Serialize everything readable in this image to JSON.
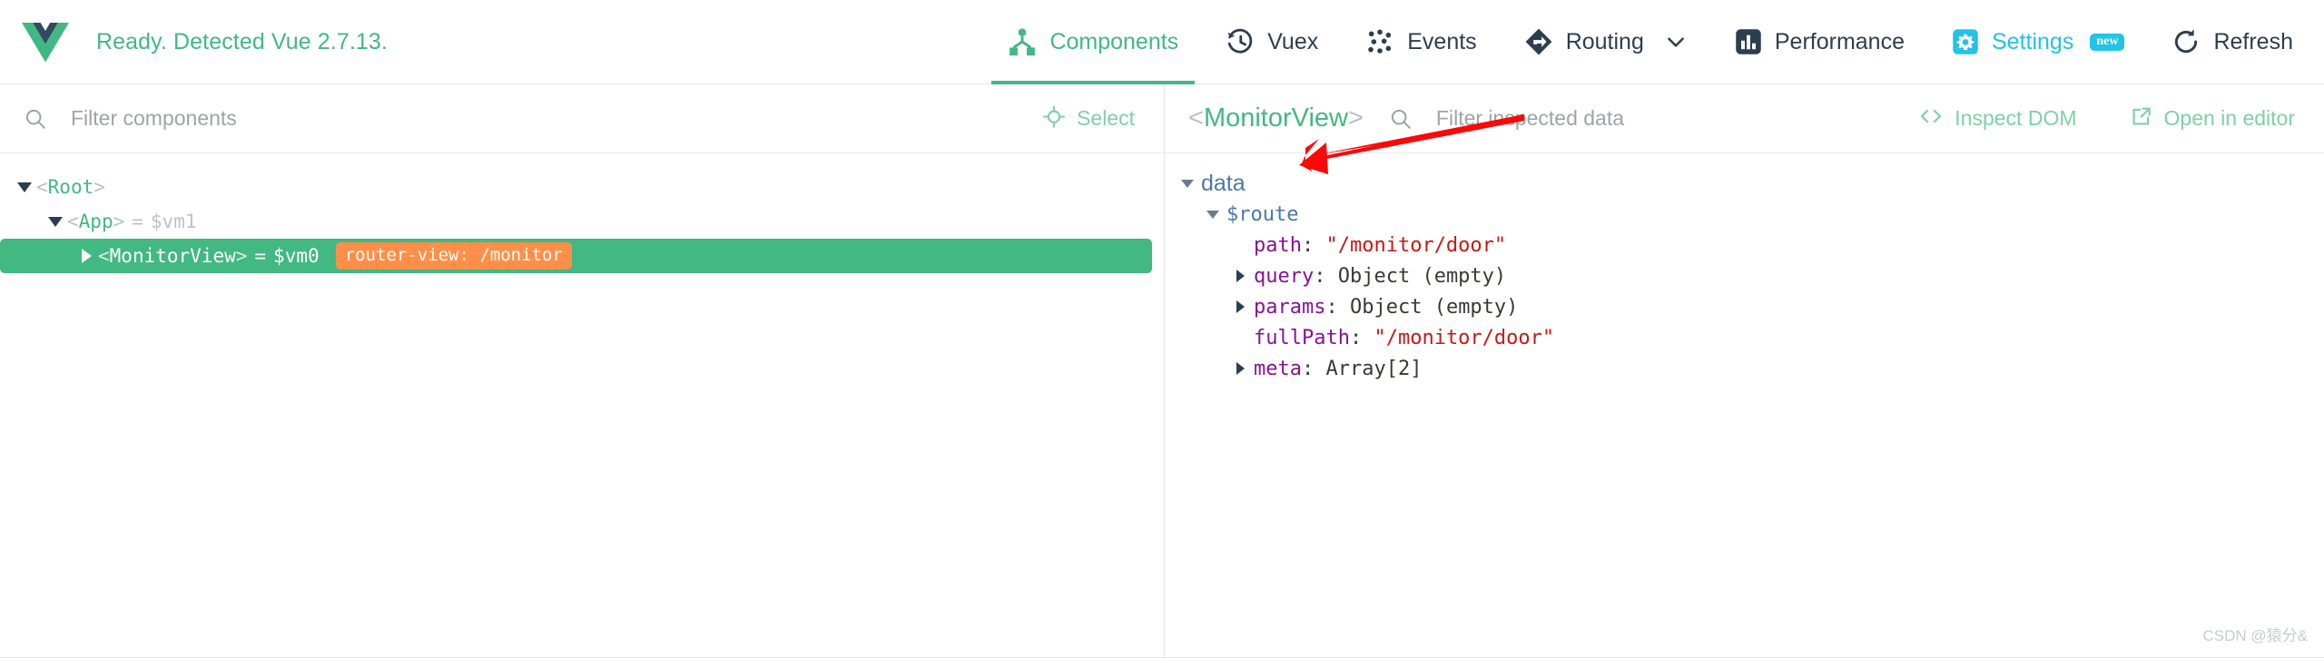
{
  "header": {
    "logo_icon": "vue-logo-icon",
    "status_text": "Ready. Detected Vue 2.7.13.",
    "accent_color": "#42b883",
    "tabs": [
      {
        "label": "Components",
        "icon": "components-tree-icon",
        "active": true
      },
      {
        "label": "Vuex",
        "icon": "history-clock-icon",
        "active": false
      },
      {
        "label": "Events",
        "icon": "events-dots-icon",
        "active": false
      },
      {
        "label": "Routing",
        "icon": "routing-diamond-arrow-icon",
        "active": false,
        "chevron": "chevron-down-icon"
      },
      {
        "label": "Performance",
        "icon": "performance-bars-icon",
        "active": false
      },
      {
        "label": "Settings",
        "icon": "gear-icon",
        "active": false,
        "badge": "new",
        "color": "#22c3e6"
      },
      {
        "label": "Refresh",
        "icon": "refresh-circular-arrow-icon",
        "active": false
      }
    ]
  },
  "left_pane": {
    "search": {
      "icon": "search-icon",
      "placeholder": "Filter components",
      "value": ""
    },
    "select_button": {
      "label": "Select",
      "icon": "crosshair-target-icon"
    },
    "tree": [
      {
        "tag_open": "<",
        "name": "Root",
        "tag_close": ">",
        "caret": "triangle-down",
        "depth": 0,
        "vm": "",
        "selected": false
      },
      {
        "tag_open": "<",
        "name": "App",
        "tag_close": ">",
        "caret": "triangle-down",
        "depth": 1,
        "eq": "=",
        "vm": "$vm1",
        "selected": false
      },
      {
        "tag_open": "<",
        "name": "MonitorView",
        "tag_close": ">",
        "caret": "triangle-right",
        "depth": 2,
        "eq": "=",
        "vm": "$vm0",
        "badge": "router-view: /monitor",
        "badge_color": "#ff8f48",
        "selected": true
      }
    ]
  },
  "right_pane": {
    "component_title": {
      "open_bracket": "<",
      "name": "MonitorView",
      "close_bracket": ">"
    },
    "search": {
      "icon": "search-icon",
      "placeholder": "Filter inspected data",
      "value": ""
    },
    "actions": [
      {
        "label": "Inspect DOM",
        "icon": "code-brackets-icon"
      },
      {
        "label": "Open in editor",
        "icon": "external-link-icon"
      }
    ],
    "inspector": {
      "group_label": "data",
      "group_caret": "triangle-down",
      "sub_label": "$route",
      "sub_caret": "triangle-down",
      "properties": [
        {
          "caret": "none",
          "key": "path",
          "value": "\"/monitor/door\"",
          "value_type": "string"
        },
        {
          "caret": "triangle-right",
          "key": "query",
          "value": "Object (empty)",
          "value_type": "object"
        },
        {
          "caret": "triangle-right",
          "key": "params",
          "value": "Object (empty)",
          "value_type": "object"
        },
        {
          "caret": "none",
          "key": "fullPath",
          "value": "\"/monitor/door\"",
          "value_type": "string"
        },
        {
          "caret": "triangle-right",
          "key": "meta",
          "value": "Array[2]",
          "value_type": "object"
        }
      ]
    },
    "annotation": {
      "type": "arrow",
      "color": "#fb0808",
      "points_to": "$route"
    }
  },
  "watermark": "CSDN @猿分&"
}
